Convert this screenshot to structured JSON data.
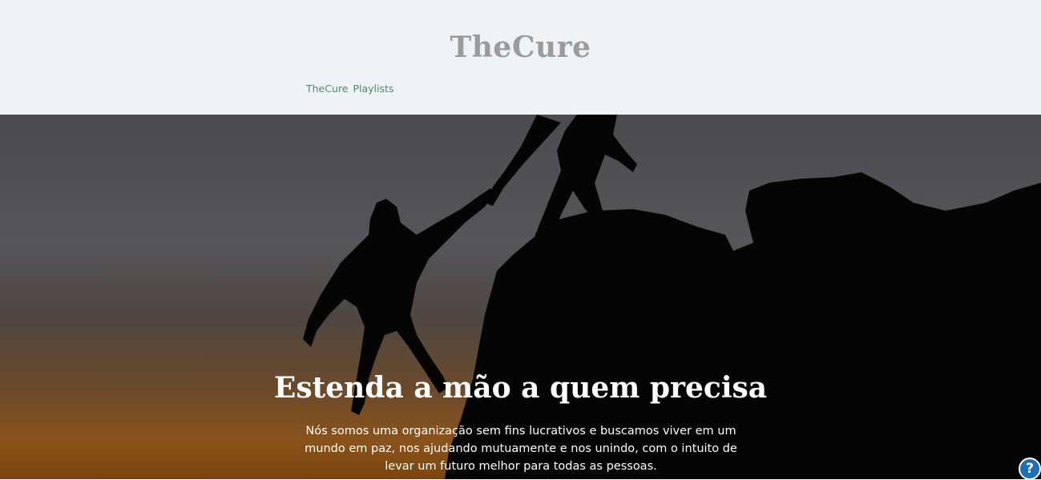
{
  "site": {
    "title": "TheCure"
  },
  "nav": {
    "items": [
      {
        "label": "TheCure"
      },
      {
        "label": "Playlists"
      }
    ]
  },
  "hero": {
    "title": "Estenda a mão a quem precisa",
    "text": "Nós somos uma organização sem fins lucrativos e buscamos viver em um mundo em paz, nos ajudando mutuamente e nos unindo, com o intuito de levar um futuro melhor para todas as pessoas.",
    "image_description_icon": "silhouettes-climbing-image"
  },
  "help": {
    "label": "?",
    "icon": "help-icon",
    "color": "#1d6fb8"
  },
  "colors": {
    "header_bg": "#eff3f6",
    "title": "#9b9b9b",
    "nav": "#4e8a70"
  }
}
